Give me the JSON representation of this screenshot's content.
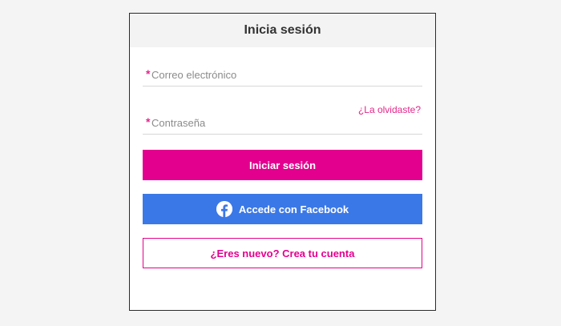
{
  "modal": {
    "title": "Inicia sesión"
  },
  "form": {
    "email": {
      "required_mark": "*",
      "placeholder": "Correo electrónico",
      "value": ""
    },
    "password": {
      "required_mark": "*",
      "placeholder": "Contraseña",
      "value": ""
    },
    "forgot_link": "¿La olvidaste?"
  },
  "buttons": {
    "login": "Iniciar sesión",
    "facebook": "Accede con Facebook",
    "register": "¿Eres nuevo? Crea tu cuenta"
  },
  "icons": {
    "facebook": "facebook-icon"
  },
  "colors": {
    "brand": "#e4008f",
    "facebook": "#3b78e7",
    "required": "#e4268a"
  }
}
